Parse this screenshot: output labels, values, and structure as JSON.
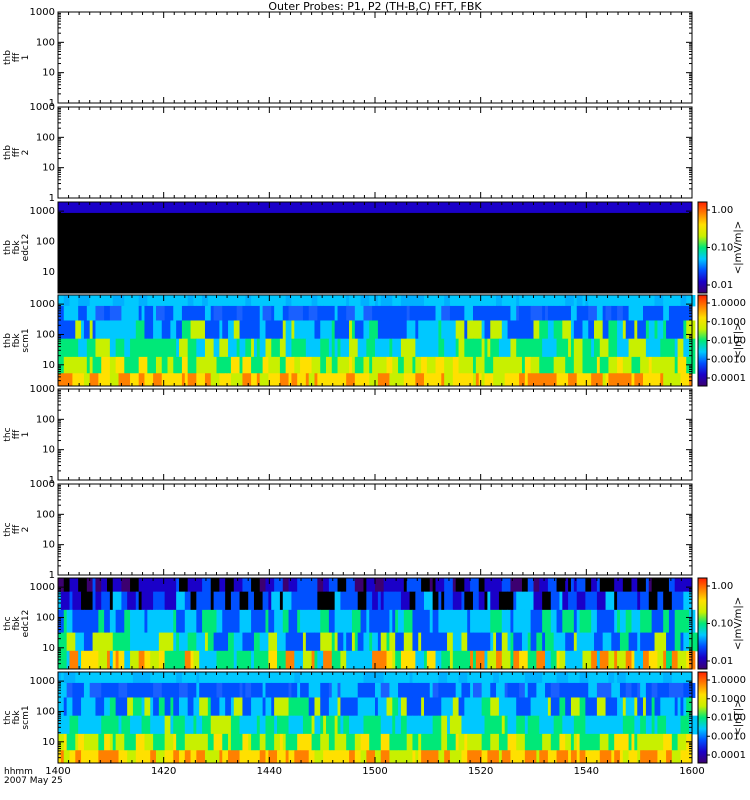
{
  "title": "Outer Probes: P1, P2 (TH-B,C) FFT, FBK",
  "footer": {
    "line1": "hhmm",
    "line2": "2007 May 25"
  },
  "colors": {
    "palette": [
      "#3c0070",
      "#1a00c8",
      "#0050ff",
      "#00c8ff",
      "#00e878",
      "#c8f000",
      "#ffe000",
      "#ff8000",
      "#ff2000"
    ]
  },
  "chart_data": [
    {
      "type": "heatmap",
      "ylabel": [
        "thb",
        "fff",
        "1"
      ],
      "ylog": true,
      "ylim": [
        1,
        1000
      ],
      "yticks": [
        "1",
        "10",
        "100",
        "1000"
      ],
      "empty": true
    },
    {
      "type": "heatmap",
      "ylabel": [
        "thb",
        "fff",
        "2"
      ],
      "ylog": true,
      "ylim": [
        1,
        1000
      ],
      "yticks": [
        "1",
        "10",
        "100",
        "1000"
      ],
      "empty": true
    },
    {
      "type": "heatmap",
      "ylabel": [
        "thb",
        "fbk",
        "edc12"
      ],
      "ylog": true,
      "ylim": [
        2,
        2000
      ],
      "yticks": [
        "10",
        "100",
        "1000"
      ],
      "pattern": "edc_thb",
      "colorbar": {
        "label": "<|mV/m|>",
        "ticks": [
          "0.01",
          "0.10",
          "1.00"
        ]
      }
    },
    {
      "type": "heatmap",
      "ylabel": [
        "thb",
        "fbk",
        "scm1"
      ],
      "ylog": true,
      "ylim": [
        2,
        2000
      ],
      "yticks": [
        "10",
        "100",
        "1000"
      ],
      "pattern": "scm",
      "colorbar": {
        "label": "<|nT|>",
        "ticks": [
          "0.0001",
          "0.0010",
          "0.0100",
          "0.1000",
          "1.0000"
        ]
      }
    },
    {
      "type": "heatmap",
      "ylabel": [
        "thc",
        "fff",
        "1"
      ],
      "ylog": true,
      "ylim": [
        1,
        1000
      ],
      "yticks": [
        "1",
        "10",
        "100",
        "1000"
      ],
      "empty": true
    },
    {
      "type": "heatmap",
      "ylabel": [
        "thc",
        "fff",
        "2"
      ],
      "ylog": true,
      "ylim": [
        1,
        1000
      ],
      "yticks": [
        "1",
        "10",
        "100",
        "1000"
      ],
      "empty": true
    },
    {
      "type": "heatmap",
      "ylabel": [
        "thc",
        "fbk",
        "edc12"
      ],
      "ylog": true,
      "ylim": [
        2,
        2000
      ],
      "yticks": [
        "10",
        "100",
        "1000"
      ],
      "pattern": "edc_thc",
      "colorbar": {
        "label": "<|mV/m|>",
        "ticks": [
          "0.01",
          "0.10",
          "1.00"
        ]
      }
    },
    {
      "type": "heatmap",
      "ylabel": [
        "thc",
        "fbk",
        "scm1"
      ],
      "ylog": true,
      "ylim": [
        2,
        2000
      ],
      "yticks": [
        "10",
        "100",
        "1000"
      ],
      "pattern": "scm",
      "colorbar": {
        "label": "<|nT|>",
        "ticks": [
          "0.0001",
          "0.0010",
          "0.0100",
          "0.1000",
          "1.0000"
        ]
      }
    }
  ],
  "x_axis": {
    "ticks": [
      "1400",
      "1420",
      "1440",
      "1500",
      "1520",
      "1540",
      "1600"
    ]
  }
}
